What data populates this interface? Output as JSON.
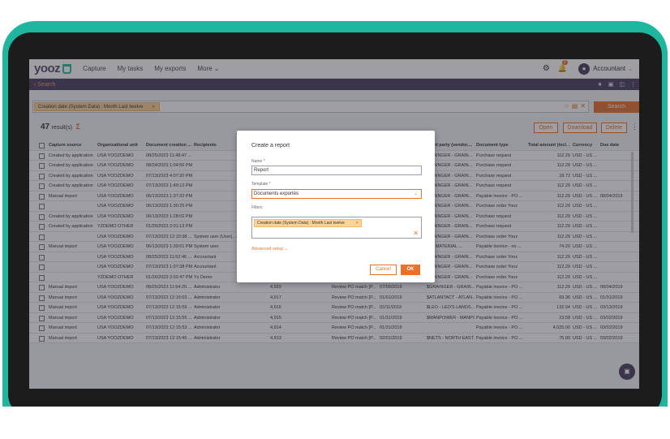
{
  "nav": {
    "logo": "yooz",
    "links": [
      "Capture",
      "My tasks",
      "My exports",
      "More"
    ],
    "account": "Accountant",
    "notification_count": "2"
  },
  "subbar": {
    "back_label": "Search"
  },
  "search": {
    "chip_label": "Creation date (System Data) : Month Last twelve",
    "button": "Search"
  },
  "results": {
    "count": "47",
    "suffix": "result(s)",
    "buttons": {
      "open": "Open",
      "download": "Download",
      "delete": "Delete"
    }
  },
  "table": {
    "columns": [
      "Capture source",
      "Organizational unit",
      "Document creation ...",
      "Recipients",
      "",
      "",
      "",
      "Third party (vendor,...",
      "Document type",
      "Total amount (incl. ...",
      "Currency",
      "Due date"
    ],
    "rows": [
      [
        "Created by application",
        "USA YOOZDEMO",
        "08/25/2023 11:48:47 ...",
        "",
        "",
        "",
        "",
        "GRAINGER - GRAIN...",
        "Purchase request",
        "112.29",
        "USD - US ...",
        ""
      ],
      [
        "Created by application",
        "USA YOOZDEMO",
        "08/24/2023 1:04:56 PM",
        "",
        "",
        "",
        "",
        "GRAINGER - GRAIN...",
        "Purchase request",
        "112.29",
        "USD - US ...",
        ""
      ],
      [
        "Created by application",
        "USA YOOZDEMO",
        "07/13/2023 4:07:20 PM",
        "",
        "",
        "",
        "",
        "GRAINGER - GRAIN...",
        "Purchase request",
        "18.72",
        "USD - US ...",
        ""
      ],
      [
        "Created by application",
        "USA YOOZDEMO",
        "07/13/2023 1:49:12 PM",
        "",
        "",
        "",
        "",
        "GRAINGER - GRAIN...",
        "Purchase request",
        "112.29",
        "USD - US ...",
        ""
      ],
      [
        "Manual import",
        "USA YOOZDEMO",
        "06/13/2023 1:37:32 PM",
        "",
        "",
        "",
        "",
        "GRAINGER - GRAIN...",
        "Payable invoice - PO ...",
        "112.29",
        "USD - US ...",
        "08/04/2019"
      ],
      [
        "",
        "USA YOOZDEMO",
        "06/13/2023 1:30:25 PM",
        "",
        "",
        "",
        "",
        "GRAINGER - GRAIN...",
        "Purchase order Yooz",
        "112.29",
        "USD - US ...",
        ""
      ],
      [
        "Created by application",
        "USA YOOZDEMO",
        "06/13/2023 1:28:02 PM",
        "",
        "",
        "",
        "",
        "GRAINGER - GRAIN...",
        "Purchase request",
        "112.29",
        "USD - US ...",
        ""
      ],
      [
        "Created by application",
        "YZDEMO OTHER",
        "01/26/2023 2:01:13 PM",
        "",
        "",
        "",
        "",
        "GRAINGER - GRAIN...",
        "Purchase request",
        "112.29",
        "USD - US ...",
        ""
      ],
      [
        "",
        "USA YOOZDEMO",
        "07/13/2023 12:10:38 ...",
        "System user (User), ...",
        "",
        "",
        "",
        "GRAINGER - GRAIN...",
        "Purchase order Yooz",
        "112.29",
        "USD - US ...",
        ""
      ],
      [
        "Manual import",
        "USA YOOZDEMO",
        "06/13/2023 1:39:01 PM",
        "System user",
        "",
        "",
        "",
        "CSI MATERIAL ...",
        "Payable invoice - no ...",
        "74.20",
        "USD - US ...",
        ""
      ],
      [
        "",
        "USA YOOZDEMO",
        "08/25/2023 11:52:46 ...",
        "Accountant",
        "",
        "",
        "",
        "GRAINGER - GRAIN...",
        "Purchase order Yooz",
        "112.29",
        "USD - US ...",
        ""
      ],
      [
        "",
        "USA YOOZDEMO",
        "07/13/2023 1:07:38 PM",
        "Accountant",
        "",
        "",
        "",
        "GRAINGER - GRAIN...",
        "Purchase order Yooz",
        "112.29",
        "USD - US ...",
        ""
      ],
      [
        "",
        "YZDEMO OTHER",
        "01/26/2023 2:02:47 PM",
        "Yz Demo",
        "",
        "",
        "",
        "GRAINGER - GRAIN...",
        "Purchase order Yooz",
        "112.29",
        "USD - US ...",
        ""
      ],
      [
        "Manual import",
        "USA YOOZDEMO",
        "08/25/2023 11:54:29 ...",
        "Administrator",
        "4,929",
        "Review PO match [P...",
        "07/05/2019",
        "$GRAINGER - GRAIN...",
        "Payable invoice - PO ...",
        "112.29",
        "USD - US ...",
        "08/04/2019"
      ],
      [
        "Manual import",
        "USA YOOZDEMO",
        "07/13/2023 12:16:03 ...",
        "Administrator",
        "4,917",
        "Review PO match [P...",
        "01/01/2019",
        "$ATLANTACT - ATLAN...",
        "Payable invoice - PO ...",
        "69.36",
        "USD - US ...",
        "01/31/2019"
      ],
      [
        "Manual import",
        "USA YOOZDEMO",
        "07/13/2023 12:15:59 ...",
        "Administrator",
        "4,916",
        "Review PO match [P...",
        "02/11/2019",
        "$LEO - LEO'S LANDS...",
        "Payable invoice - PO ...",
        "132.94",
        "USD - US ...",
        "03/13/2019"
      ],
      [
        "Manual import",
        "USA YOOZDEMO",
        "07/13/2023 12:15:55 ...",
        "Administrator",
        "4,915",
        "Review PO match [P...",
        "01/31/2019",
        "$MANPOWER - MANPO...",
        "Payable invoice - PO ...",
        "23.58",
        "USD - US ...",
        "03/02/2019"
      ],
      [
        "Manual import",
        "USA YOOZDEMO",
        "07/13/2023 12:15:53 ...",
        "Administrator",
        "4,914",
        "Review PO match [P...",
        "01/31/2019",
        "",
        "Payable invoice - PO ...",
        "4,025.00",
        "USD - US ...",
        "03/02/2019"
      ],
      [
        "Manual import",
        "USA YOOZDEMO",
        "07/13/2023 12:15:45 ...",
        "Administrator",
        "4,913",
        "Review PO match [P...",
        "02/01/2019",
        "$NETS - NORTH EAST...",
        "Payable invoice - PO ...",
        "75.00",
        "USD - US ...",
        "03/02/2019"
      ]
    ]
  },
  "dialog": {
    "title": "Create a report",
    "name_label": "Name *",
    "name_value": "Report",
    "template_label": "Template *",
    "template_value": "Documents exportés",
    "filters_label": "Filters",
    "filter_chip": "Creation date (System Data) : Month Last twelve",
    "advanced": "Advanced setup",
    "cancel": "Cancel",
    "ok": "OK"
  },
  "colors": {
    "accent": "#e8722a",
    "brand": "#4b3f5e",
    "teal": "#1fb6a0"
  }
}
